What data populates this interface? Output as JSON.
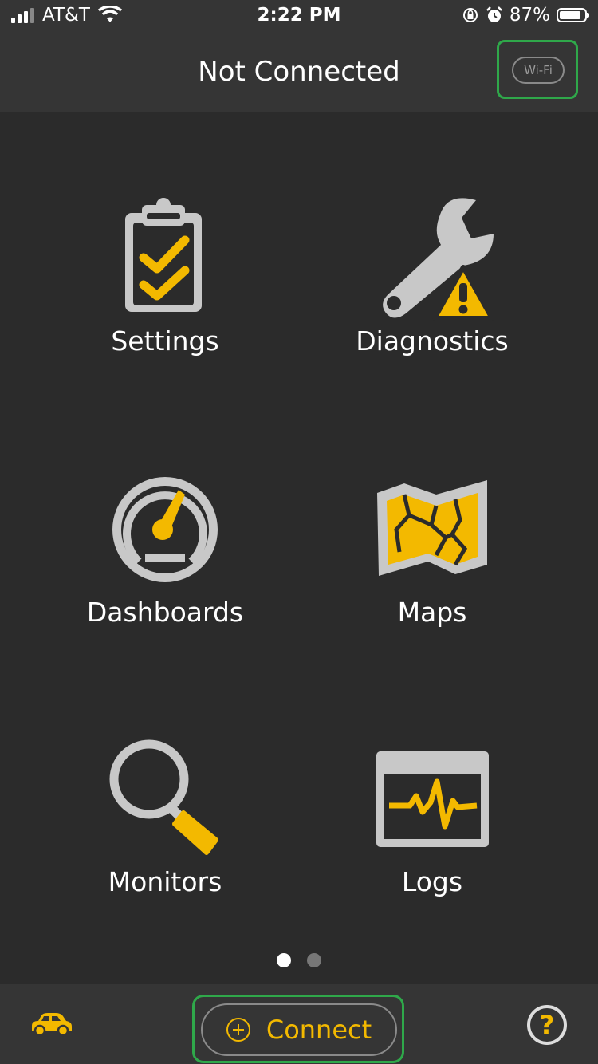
{
  "status": {
    "carrier": "AT&T",
    "time": "2:22 PM",
    "battery": "87%",
    "battery_level": 0.87
  },
  "header": {
    "title": "Not Connected",
    "wifi_label": "Wi-Fi"
  },
  "menu": {
    "settings": "Settings",
    "diagnostics": "Diagnostics",
    "dashboards": "Dashboards",
    "maps": "Maps",
    "monitors": "Monitors",
    "logs": "Logs"
  },
  "pager": {
    "pages": 2,
    "current": 1
  },
  "bottom": {
    "connect_label": "Connect",
    "help_label": "?"
  },
  "colors": {
    "accent": "#f3b900",
    "icon_gray": "#c8c8c8",
    "highlight": "#2fa84a",
    "background": "#2b2b2b",
    "bar": "#353535"
  }
}
